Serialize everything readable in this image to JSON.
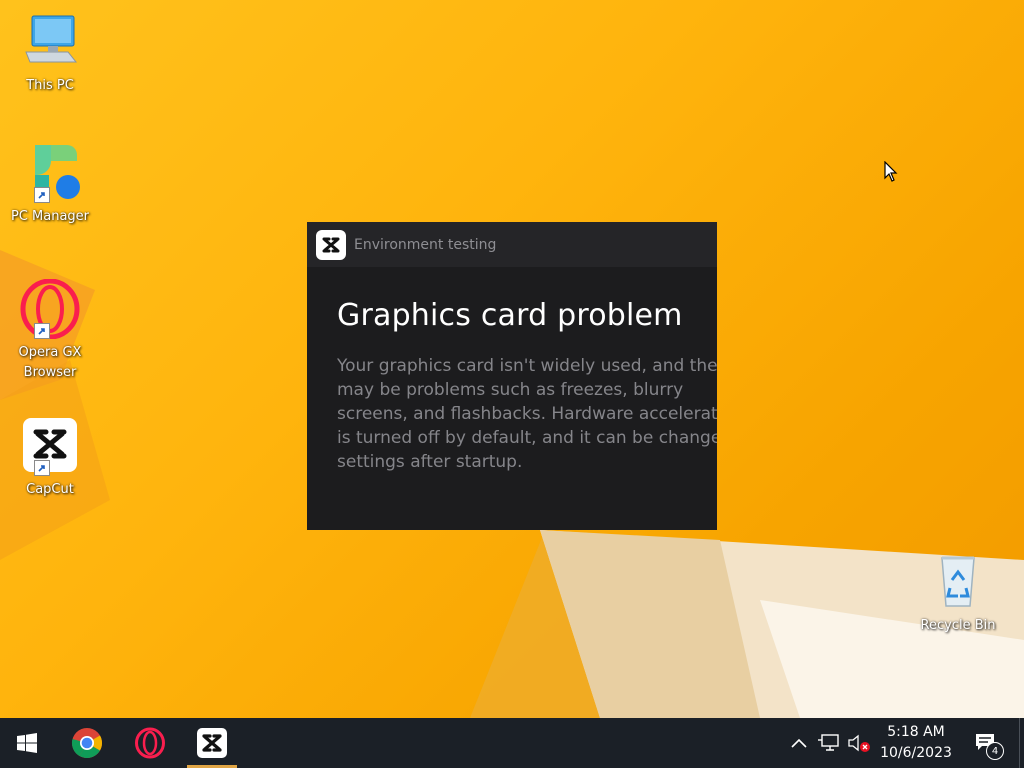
{
  "desktop": {
    "icons": [
      {
        "label": "This PC",
        "icon": "this-pc-icon"
      },
      {
        "label": "PC Manager",
        "icon": "pc-manager-icon"
      },
      {
        "label": "Opera GX\nBrowser",
        "icon": "opera-gx-icon"
      },
      {
        "label": "CapCut",
        "icon": "capcut-icon"
      },
      {
        "label": "Recycle Bin",
        "icon": "recycle-bin-icon"
      }
    ]
  },
  "dialog": {
    "title": "Environment testing",
    "app_icon": "capcut-icon",
    "heading": "Graphics card problem",
    "message": "Your graphics card isn't widely used, and there may be problems such as freezes, blurry screens, and flashbacks. Hardware acceleration is turned off by default, and it can be changed in settings after startup."
  },
  "taskbar": {
    "start_icon": "windows-start-icon",
    "apps": [
      {
        "name": "Google Chrome",
        "icon": "chrome-icon",
        "active": false
      },
      {
        "name": "Opera GX",
        "icon": "opera-gx-icon",
        "active": false
      },
      {
        "name": "CapCut",
        "icon": "capcut-icon",
        "active": true
      }
    ],
    "tray": {
      "chevron_icon": "chevron-up-icon",
      "network_icon": "network-icon",
      "volume_icon": "volume-muted-icon",
      "time": "5:18 AM",
      "date": "10/6/2023",
      "notification_count": "4",
      "notification_icon": "action-center-icon"
    }
  },
  "colors": {
    "wallpaper": "#ffb40d",
    "dialog_bg": "#1c1c1e",
    "taskbar_bg": "#1b2027",
    "active_indicator": "#e0a545"
  }
}
